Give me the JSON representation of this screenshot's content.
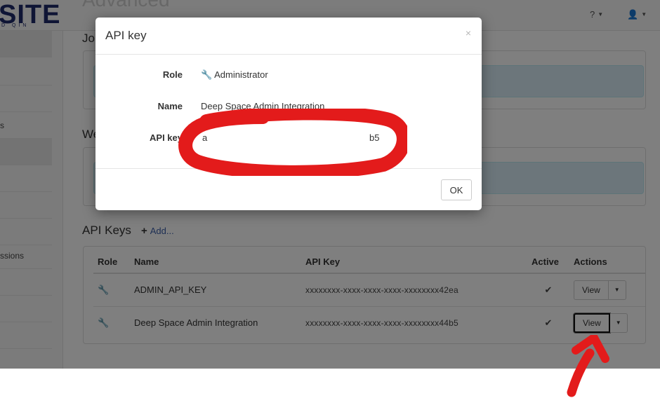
{
  "app": {
    "logo": "SITE",
    "logo_sub": "D QIN",
    "page_title": "Advanced",
    "help_icon": "question-circle-icon",
    "user_icon": "user-icon"
  },
  "sidebar": {
    "items": [
      {
        "label": ""
      },
      {
        "label": ""
      },
      {
        "label": ""
      },
      {
        "label": "s"
      },
      {
        "label": ""
      },
      {
        "label": ""
      },
      {
        "label": ""
      },
      {
        "label": ""
      },
      {
        "label": "ssions"
      },
      {
        "label": ""
      },
      {
        "label": ""
      },
      {
        "label": ""
      }
    ]
  },
  "sections": {
    "jobs_heading": "Jol",
    "webhooks_heading": "We"
  },
  "api_keys": {
    "heading": "API Keys",
    "add_label": "Add...",
    "columns": {
      "role": "Role",
      "name": "Name",
      "key": "API Key",
      "active": "Active",
      "actions": "Actions"
    },
    "rows": [
      {
        "name": "ADMIN_API_KEY",
        "key": "xxxxxxxx-xxxx-xxxx-xxxx-xxxxxxxx42ea",
        "view_label": "View"
      },
      {
        "name": "Deep Space Admin Integration",
        "key": "xxxxxxxx-xxxx-xxxx-xxxx-xxxxxxxx44b5",
        "view_label": "View"
      }
    ]
  },
  "modal": {
    "title": "API key",
    "close": "×",
    "role_label": "Role",
    "role_value": "Administrator",
    "name_label": "Name",
    "name_value": "Deep Space Admin Integration",
    "key_label": "API key",
    "key_start": "a",
    "key_end": "b5",
    "ok_label": "OK"
  },
  "colors": {
    "annotation_red": "#e31b1b",
    "brand_navy": "#1f2a6b",
    "link_blue": "#3b5ea8"
  }
}
